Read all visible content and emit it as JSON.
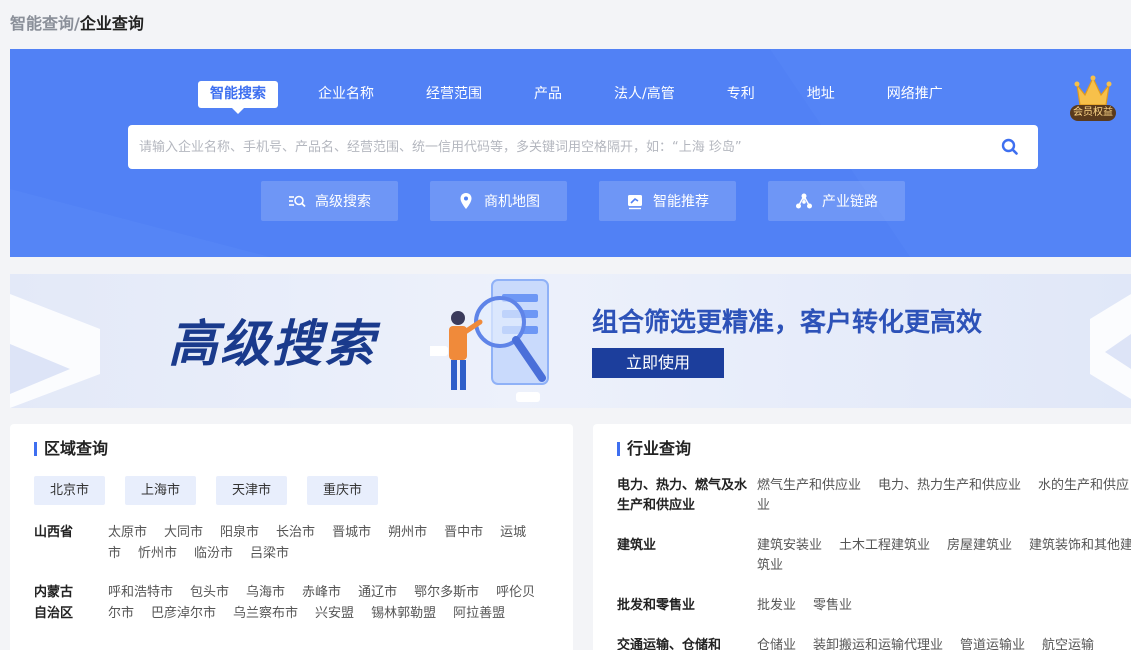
{
  "breadcrumb": {
    "root": "智能查询",
    "separator": "/",
    "current": "企业查询"
  },
  "hero": {
    "tabs": [
      {
        "label": "智能搜索",
        "active": true
      },
      {
        "label": "企业名称"
      },
      {
        "label": "经营范围"
      },
      {
        "label": "产品"
      },
      {
        "label": "法人/高管"
      },
      {
        "label": "专利"
      },
      {
        "label": "地址"
      },
      {
        "label": "网络推广"
      }
    ],
    "vip_label": "会员权益",
    "search_placeholder": "请输入企业名称、手机号、产品名、经营范围、统一信用代码等，多关键词用空格隔开，如：“上海 珍岛”",
    "search_value": "",
    "quick_actions": [
      {
        "label": "高级搜索",
        "icon": "advanced-search-icon"
      },
      {
        "label": "商机地图",
        "icon": "map-pin-icon"
      },
      {
        "label": "智能推荐",
        "icon": "recommend-icon"
      },
      {
        "label": "产业链路",
        "icon": "chain-icon"
      }
    ],
    "accent_color": "#5181f5"
  },
  "banner": {
    "title": "高级搜索",
    "slogan": "组合筛选更精准，客户转化更高效",
    "cta": "立即使用"
  },
  "region": {
    "title": "区域查询",
    "municipalities": [
      "北京市",
      "上海市",
      "天津市",
      "重庆市"
    ],
    "provinces": [
      {
        "name": "山西省",
        "cities": [
          "太原市",
          "大同市",
          "阳泉市",
          "长治市",
          "晋城市",
          "朔州市",
          "晋中市",
          "运城市",
          "忻州市",
          "临汾市",
          "吕梁市"
        ]
      },
      {
        "name": "内蒙古自治区",
        "cities": [
          "呼和浩特市",
          "包头市",
          "乌海市",
          "赤峰市",
          "通辽市",
          "鄂尔多斯市",
          "呼伦贝尔市",
          "巴彦淖尔市",
          "乌兰察布市",
          "兴安盟",
          "锡林郭勒盟",
          "阿拉善盟"
        ]
      }
    ]
  },
  "industry": {
    "title": "行业查询",
    "categories": [
      {
        "name": "电力、热力、燃气及水生产和供应业",
        "subs": [
          "燃气生产和供应业",
          "电力、热力生产和供应业",
          "水的生产和供应业"
        ]
      },
      {
        "name": "建筑业",
        "subs": [
          "建筑安装业",
          "土木工程建筑业",
          "房屋建筑业",
          "建筑装饰和其他建筑业"
        ]
      },
      {
        "name": "批发和零售业",
        "subs": [
          "批发业",
          "零售业"
        ]
      },
      {
        "name": "交通运输、仓储和",
        "subs": [
          "仓储业",
          "装卸搬运和运输代理业",
          "管道运输业",
          "航空运输"
        ]
      }
    ]
  }
}
